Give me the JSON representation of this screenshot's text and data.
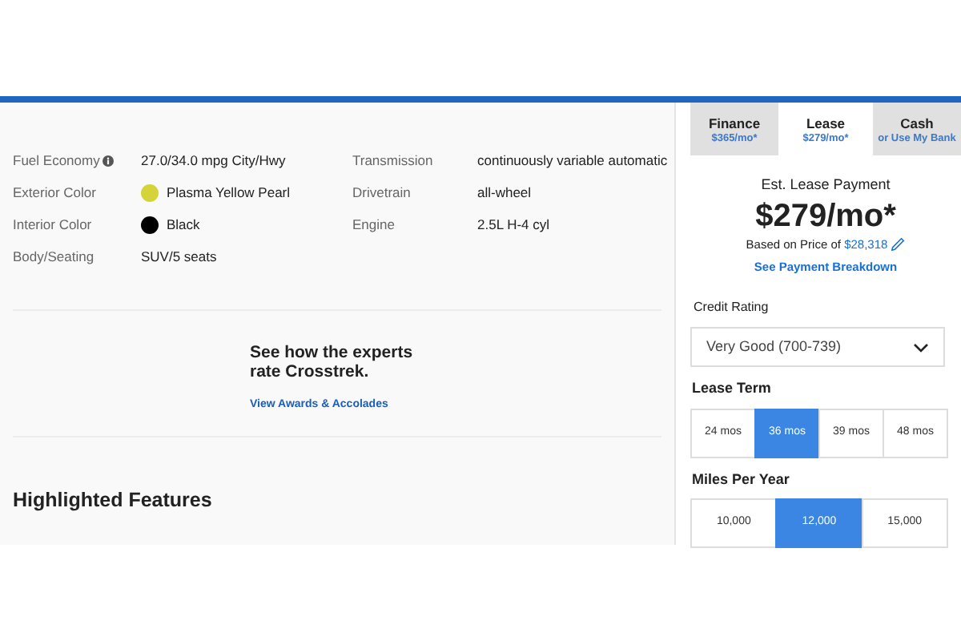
{
  "specs": [
    {
      "label": "Fuel Economy",
      "kind": "info",
      "value": "27.0/34.0 mpg City/Hwy"
    },
    {
      "label": "Transmission",
      "kind": "plain",
      "value": "continuously variable automatic"
    },
    {
      "label": "Exterior Color",
      "kind": "color",
      "color": "#d4d43a",
      "value": "Plasma Yellow Pearl"
    },
    {
      "label": "Drivetrain",
      "kind": "plain",
      "value": "all-wheel"
    },
    {
      "label": "Interior Color",
      "kind": "color",
      "color": "#000000",
      "value": "Black"
    },
    {
      "label": "Engine",
      "kind": "plain",
      "value": "2.5L H-4 cyl"
    },
    {
      "label": "Body/Seating",
      "kind": "plain",
      "value": "SUV/5 seats"
    }
  ],
  "experts": {
    "heading": "See how the experts rate Crosstrek.",
    "link": "View Awards & Accolades"
  },
  "section_title": "Highlighted Features",
  "payment": {
    "tabs": [
      {
        "title": "Finance",
        "subtitle": "$365/mo*",
        "selected": false
      },
      {
        "title": "Lease",
        "subtitle": "$279/mo*",
        "selected": true
      },
      {
        "title": "Cash",
        "subtitle": "or Use My Bank",
        "selected": false
      }
    ],
    "estimate_label": "Est. Lease Payment",
    "amount": "$279/mo*",
    "based_on": "Based on Price of",
    "price": "$28,318",
    "breakdown_link": "See Payment Breakdown",
    "credit_label": "Credit Rating",
    "credit_value": "Very Good (700-739)",
    "term_label": "Lease Term",
    "terms": [
      {
        "label": "24 mos",
        "selected": false
      },
      {
        "label": "36 mos",
        "selected": true
      },
      {
        "label": "39 mos",
        "selected": false
      },
      {
        "label": "48 mos",
        "selected": false
      }
    ],
    "miles_label": "Miles Per Year",
    "miles": [
      {
        "label": "10,000",
        "selected": false
      },
      {
        "label": "12,000",
        "selected": true
      },
      {
        "label": "15,000",
        "selected": false
      }
    ]
  }
}
